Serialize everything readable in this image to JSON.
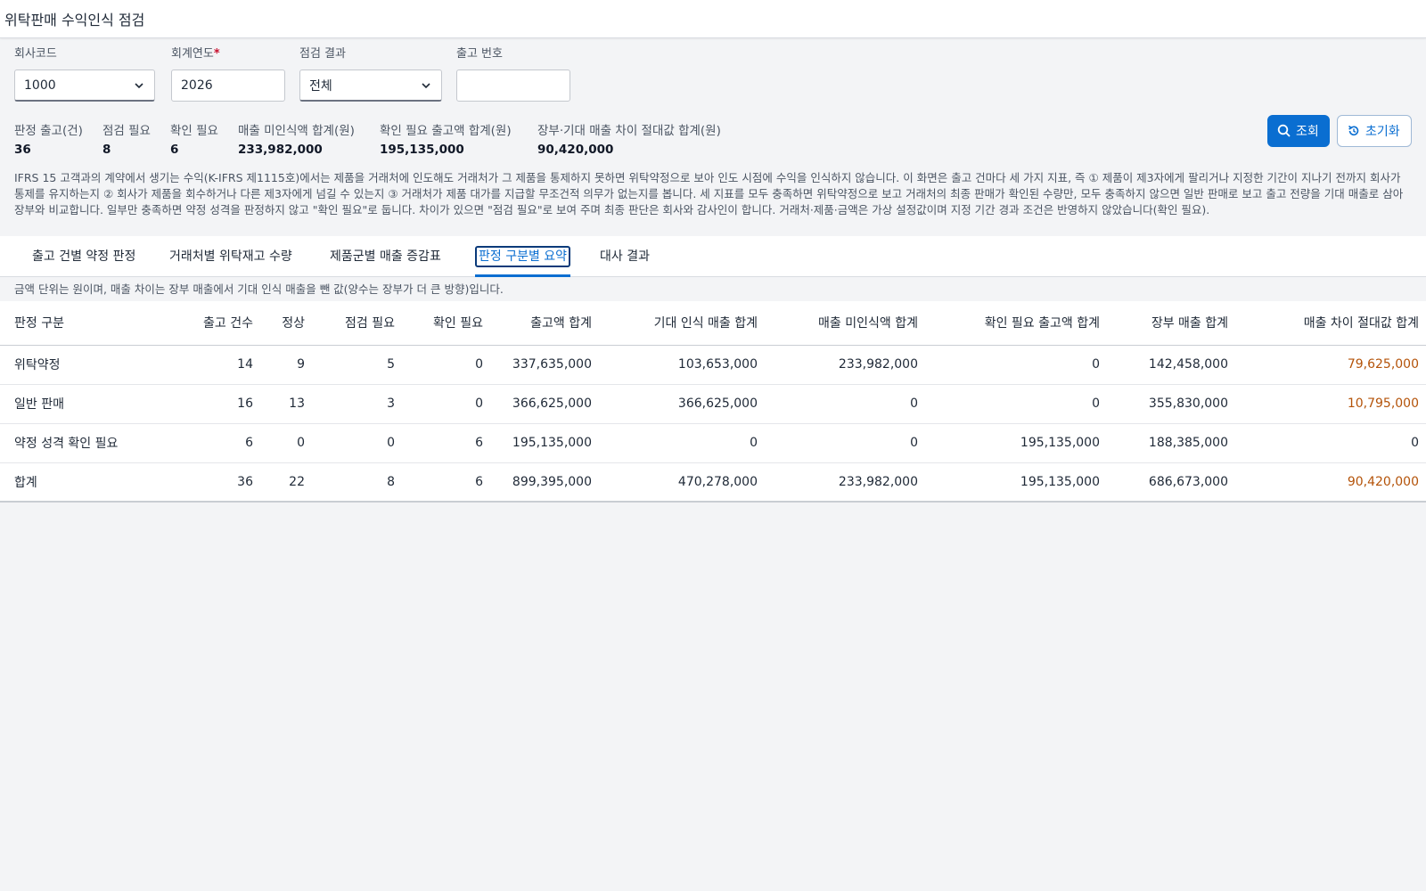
{
  "app": {
    "title": "위탁판매 수익인식 점검"
  },
  "filters": {
    "company": {
      "label": "회사코드",
      "value": "1000"
    },
    "year": {
      "label": "회계연도",
      "required_mark": "*",
      "value": "2026"
    },
    "result": {
      "label": "점검 결과",
      "value": "전체"
    },
    "shipment": {
      "label": "출고 번호",
      "value": ""
    }
  },
  "actions": {
    "search_label": "조회",
    "reset_label": "초기화"
  },
  "kpis": [
    {
      "label": "판정 출고(건)",
      "value": "36"
    },
    {
      "label": "점검 필요",
      "value": "8"
    },
    {
      "label": "확인 필요",
      "value": "6"
    },
    {
      "label": "매출 미인식액 합계(원)",
      "value": "233,982,000"
    },
    {
      "label": "확인 필요 출고액 합계(원)",
      "value": "195,135,000"
    },
    {
      "label": "장부·기대 매출 차이 절대값 합계(원)",
      "value": "90,420,000"
    }
  ],
  "description": "IFRS 15 고객과의 계약에서 생기는 수익(K-IFRS 제1115호)에서는 제품을 거래처에 인도해도 거래처가 그 제품을 통제하지 못하면 위탁약정으로 보아 인도 시점에 수익을 인식하지 않습니다. 이 화면은 출고 건마다 세 가지 지표, 즉 ① 제품이 제3자에게 팔리거나 지정한 기간이 지나기 전까지 회사가 통제를 유지하는지 ② 회사가 제품을 회수하거나 다른 제3자에게 넘길 수 있는지 ③ 거래처가 제품 대가를 지급할 무조건적 의무가 없는지를 봅니다. 세 지표를 모두 충족하면 위탁약정으로 보고 거래처의 최종 판매가 확인된 수량만, 모두 충족하지 않으면 일반 판매로 보고 출고 전량을 기대 매출로 삼아 장부와 비교합니다. 일부만 충족하면 약정 성격을 판정하지 않고 \"확인 필요\"로 둡니다. 차이가 있으면 \"점검 필요\"로 보여 주며 최종 판단은 회사와 감사인이 합니다. 거래처·제품·금액은 가상 설정값이며 지정 기간 경과 조건은 반영하지 않았습니다(확인 필요).",
  "tabs": [
    {
      "label": "출고 건별 약정 판정"
    },
    {
      "label": "거래처별 위탁재고 수량"
    },
    {
      "label": "제품군별 매출 증감표"
    },
    {
      "label": "판정 구분별 요약"
    },
    {
      "label": "대사 결과"
    }
  ],
  "note": "금액 단위는 원이며, 매출 차이는 장부 매출에서 기대 인식 매출을 뺀 값(양수는 장부가 더 큰 방향)입니다.",
  "table": {
    "headers": [
      "판정 구분",
      "출고 건수",
      "정상",
      "점검 필요",
      "확인 필요",
      "출고액 합계",
      "기대 인식 매출 합계",
      "매출 미인식액 합계",
      "확인 필요 출고액 합계",
      "장부 매출 합계",
      "매출 차이 절대값 합계"
    ],
    "rows": [
      [
        "위탁약정",
        "14",
        "9",
        "5",
        "0",
        "337,635,000",
        "103,653,000",
        "233,982,000",
        "0",
        "142,458,000",
        "79,625,000"
      ],
      [
        "일반 판매",
        "16",
        "13",
        "3",
        "0",
        "366,625,000",
        "366,625,000",
        "0",
        "0",
        "355,830,000",
        "10,795,000"
      ],
      [
        "약정 성격 확인 필요",
        "6",
        "0",
        "0",
        "6",
        "195,135,000",
        "0",
        "0",
        "195,135,000",
        "188,385,000",
        "0"
      ],
      [
        "합계",
        "36",
        "22",
        "8",
        "6",
        "899,395,000",
        "470,278,000",
        "233,982,000",
        "195,135,000",
        "686,673,000",
        "90,420,000"
      ]
    ]
  },
  "colors": {
    "accent": "#0a6ed1",
    "warn": "#b45309",
    "required": "#c8102e"
  }
}
